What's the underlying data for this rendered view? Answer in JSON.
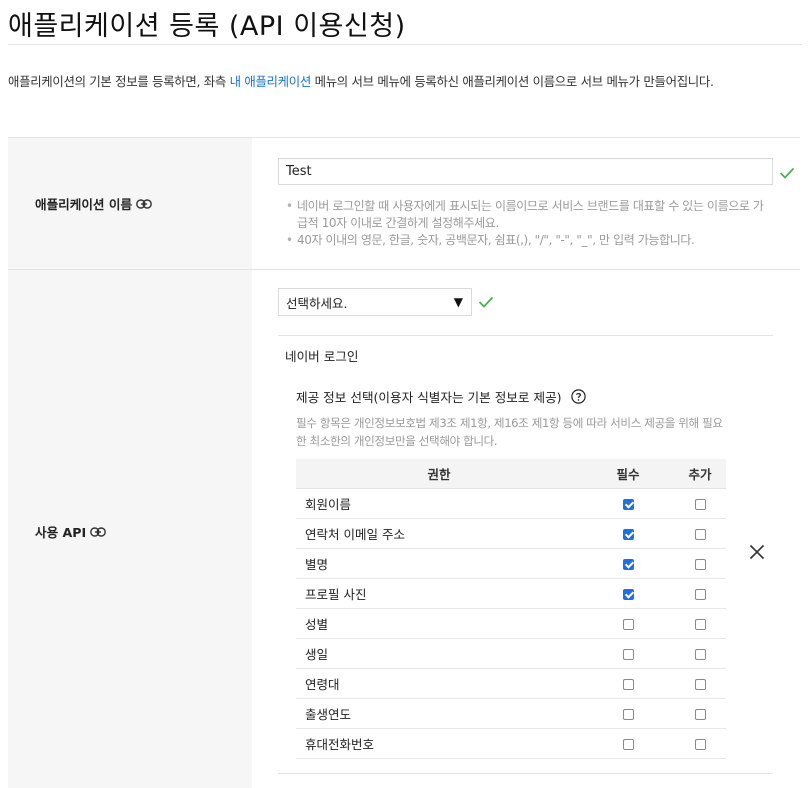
{
  "header": {
    "title": "애플리케이션 등록 (API 이용신청)"
  },
  "intro": {
    "before_link": "애플리케이션의 기본 정보를 등록하면, 좌측 ",
    "link": "내 애플리케이션",
    "after_link": " 메뉴의 서브 메뉴에 등록하신 애플리케이션 이름으로 서브 메뉴가 만들어집니다."
  },
  "app_name_row": {
    "label": "애플리케이션 이름",
    "input_value": "Test",
    "hints": [
      "네이버 로그인할 때 사용자에게 표시되는 이름이므로 서비스 브랜드를 대표할 수 있는 이름으로 가급적 10자 이내로 간결하게 설정해주세요.",
      "40자 이내의 영문, 한글, 숫자, 공백문자, 쉼표(,), \"/\", \"-\", \"_\", 만 입력 가능합니다."
    ]
  },
  "api_row": {
    "label": "사용 API",
    "select_value": "선택하세요.",
    "api_name": "네이버 로그인",
    "provide_title": "제공 정보 선택(이용자 식별자는 기본 정보로 제공)",
    "provide_note": "필수 항목은 개인정보보호법 제3조 제1항, 제16조 제1항 등에 따라 서비스 제공을 위해 필요한 최소한의 개인정보만을 선택해야 합니다.",
    "table": {
      "headers": [
        "권한",
        "필수",
        "추가"
      ],
      "rows": [
        {
          "name": "회원이름",
          "required": true,
          "additional": false
        },
        {
          "name": "연락처 이메일 주소",
          "required": true,
          "additional": false
        },
        {
          "name": "별명",
          "required": true,
          "additional": false
        },
        {
          "name": "프로필 사진",
          "required": true,
          "additional": false
        },
        {
          "name": "성별",
          "required": false,
          "additional": false
        },
        {
          "name": "생일",
          "required": false,
          "additional": false
        },
        {
          "name": "연령대",
          "required": false,
          "additional": false
        },
        {
          "name": "출생연도",
          "required": false,
          "additional": false
        },
        {
          "name": "휴대전화번호",
          "required": false,
          "additional": false
        }
      ]
    }
  },
  "colors": {
    "link": "#1a73c9",
    "valid_check": "#4caf50",
    "checkbox_checked": "#1f6fe0",
    "label_bg": "#f6f6f6"
  },
  "icons": {
    "label_link": "link-icon",
    "valid": "check-icon",
    "help": "question-circle-icon",
    "remove": "close-icon",
    "dropdown": "caret-down-icon"
  }
}
